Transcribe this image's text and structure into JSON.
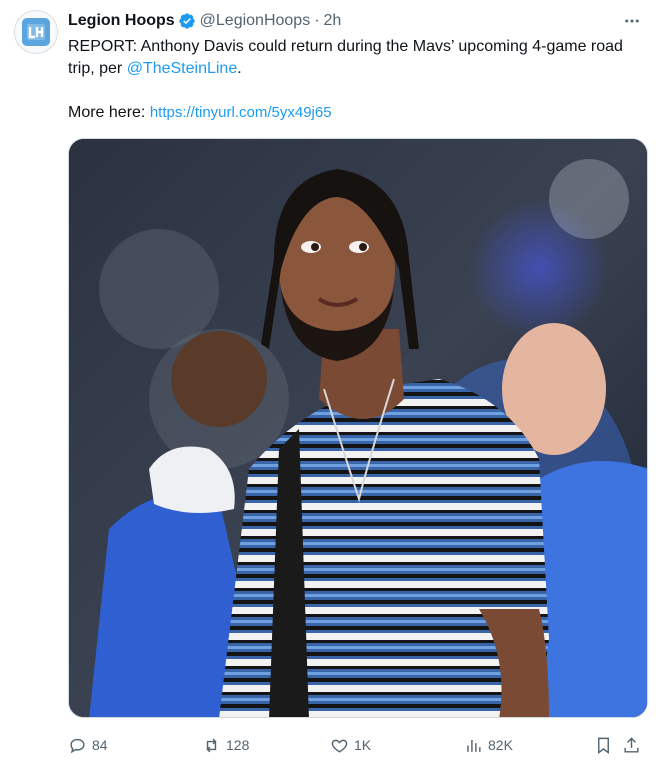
{
  "author": {
    "name": "Legion Hoops",
    "handle": "@LegionHoops",
    "separator": "·",
    "time": "2h",
    "avatar_icon": "legion-hoops-logo"
  },
  "tweet": {
    "text_main": "REPORT: Anthony Davis could return during the Mavs’ upcoming 4-game road trip, per ",
    "mention": "@TheSteinLine",
    "text_end": ".",
    "more_prefix": "More here: ",
    "link": "https://tinyurl.com/5yx49j65"
  },
  "actions": {
    "replies": "84",
    "retweets": "128",
    "likes": "1K",
    "views": "82K"
  },
  "colors": {
    "link": "#1d9bf0",
    "secondary_text": "#536471",
    "verified": "#1d9bf0"
  }
}
